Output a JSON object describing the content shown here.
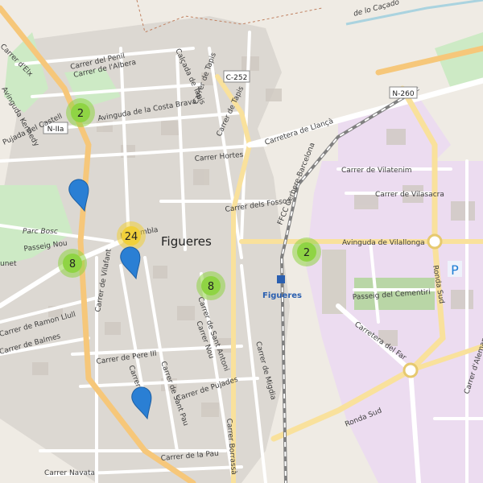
{
  "city": "Figueres",
  "station": "Figueres",
  "railway": "FFCC Cerbere-Barcelona",
  "area_top": "de lo Caçado",
  "park": "Parc Bosc",
  "shields": [
    "C-252",
    "N-IIa",
    "N-260"
  ],
  "streets": {
    "peni": "Carrer del Penil",
    "albera": "Carrer de l'Albera",
    "costa_brava": "Avinguda de la Costa Brava",
    "tapis1": "Carrer de Tapis",
    "tapis2": "Carrer de Tapis",
    "calcada": "Calçada de Tapis",
    "llanca": "Carretera de Llançà",
    "hortes": "Carrer Hortes",
    "fossos": "Carrer dels Fossos",
    "vilatenim": "Carrer de Vilatenim",
    "vilasacra": "Carrer de Vilasacra",
    "villalonga": "Avinguda de Vilallonga",
    "cementiri": "Passeig del Cementiri",
    "par": "Carretera del Far",
    "ronda_sud1": "Ronda Sud",
    "ronda_sud2": "Ronda Sud",
    "alemanya": "Carrer d'Alemanya",
    "passeig_nou": "Passeig Nou",
    "vilafant": "Carrer de Vilafant",
    "ramon_llull": "Carrer de Ramon Llull",
    "balmes": "Carrer de Balmes",
    "pere_iii": "Carrer de Pere III",
    "sant_antoni": "Carrer de Sant Antoni",
    "nou": "Carrer Nou",
    "migdia": "Carrer de Migdia",
    "pujades": "Carrer de Pujades",
    "sant_pau": "Carrer de Sant Pau",
    "borrassa": "Carrer Borrassà",
    "la_pau": "Carrer de la Pau",
    "navata": "Carrer Navata",
    "kennedy": "Avinguda Kennedy",
    "castell": "Pujada del Castell",
    "elx": "Carrer d'Elx",
    "rambla": "La Rambla",
    "sal": "Carrer de Sa...",
    "unet": "unet"
  },
  "clusters": [
    {
      "count": "2",
      "color": "#8fd444"
    },
    {
      "count": "24",
      "color": "#f1d03a"
    },
    {
      "count": "8",
      "color": "#8fd444"
    },
    {
      "count": "8",
      "color": "#8fd444"
    },
    {
      "count": "2",
      "color": "#8fd444"
    }
  ],
  "markers": 3,
  "parking_symbol": "P",
  "colors": {
    "background": "#efebe4",
    "residential": "#dcd8d2",
    "railway_area": "#ecdcf0",
    "park": "#cdeac5",
    "major_road": "#f9e19c",
    "trunk": "#f6c77a",
    "marker": "#2a7fd4",
    "water": "#aad3df"
  }
}
